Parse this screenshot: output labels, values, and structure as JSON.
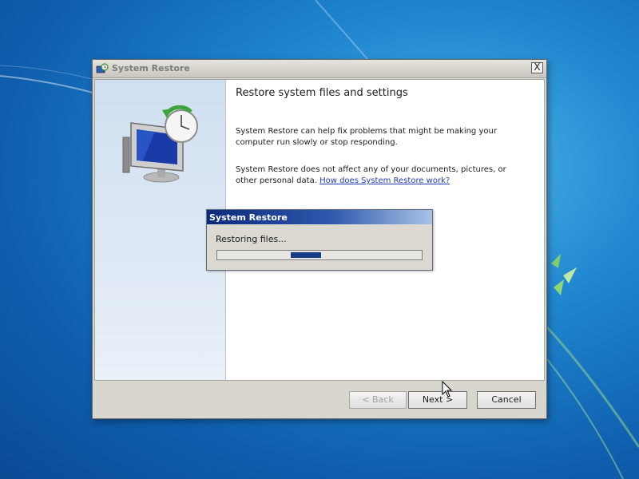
{
  "window": {
    "title": "System Restore",
    "close_label": "X"
  },
  "page": {
    "heading": "Restore system files and settings",
    "paragraph1": "System Restore can help fix problems that might be making your computer run slowly or stop responding.",
    "paragraph2": "System Restore does not affect any of your documents, pictures, or other personal data.",
    "help_link": "How does System Restore work?"
  },
  "buttons": {
    "back": "< Back",
    "next": "Next >",
    "cancel": "Cancel"
  },
  "progress_dialog": {
    "title": "System Restore",
    "status": "Restoring files...",
    "indeterminate_block_position": 0.42
  },
  "icons": {
    "app": "system-restore-icon",
    "hero": "computer-with-clock-icon",
    "close": "close-icon",
    "cursor": "mouse-pointer-icon"
  },
  "colors": {
    "desktop_blue": "#1f86cf",
    "progress_title_blue": "#0b2a7a",
    "progress_fill": "#163b87",
    "link_blue": "#1f3fb3"
  }
}
